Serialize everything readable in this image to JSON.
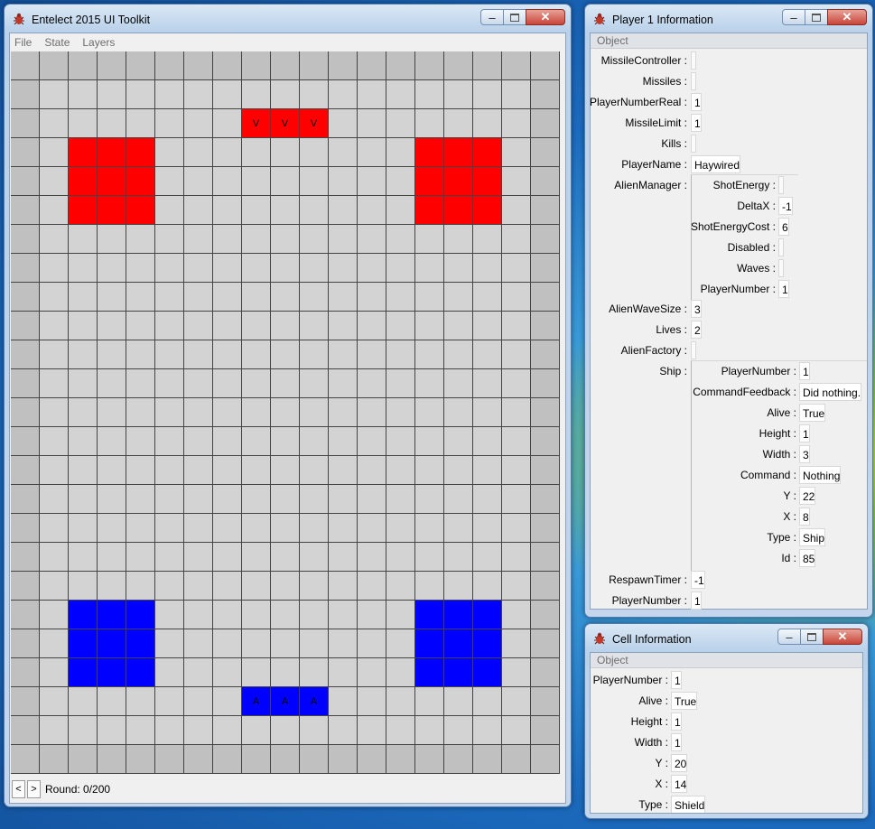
{
  "main_window": {
    "title": "Entelect 2015 UI Toolkit",
    "menu": [
      "File",
      "State",
      "Layers"
    ],
    "round_label": "Round: 0/200",
    "prev_label": "<",
    "next_label": ">"
  },
  "board": {
    "cols": 19,
    "rows": 25,
    "colors": {
      "floor": "#d3d3d3",
      "wall": "#c0c0c0",
      "red": "#ff0000",
      "blue": "#0000ff"
    },
    "red_shields": [
      [
        2,
        3
      ],
      [
        3,
        3
      ],
      [
        4,
        3
      ],
      [
        2,
        4
      ],
      [
        3,
        4
      ],
      [
        4,
        4
      ],
      [
        2,
        5
      ],
      [
        3,
        5
      ],
      [
        4,
        5
      ],
      [
        14,
        3
      ],
      [
        15,
        3
      ],
      [
        16,
        3
      ],
      [
        14,
        4
      ],
      [
        15,
        4
      ],
      [
        16,
        4
      ],
      [
        14,
        5
      ],
      [
        15,
        5
      ],
      [
        16,
        5
      ]
    ],
    "blue_shields": [
      [
        2,
        19
      ],
      [
        3,
        19
      ],
      [
        4,
        19
      ],
      [
        2,
        20
      ],
      [
        3,
        20
      ],
      [
        4,
        20
      ],
      [
        2,
        21
      ],
      [
        3,
        21
      ],
      [
        4,
        21
      ],
      [
        14,
        19
      ],
      [
        15,
        19
      ],
      [
        16,
        19
      ],
      [
        14,
        20
      ],
      [
        15,
        20
      ],
      [
        16,
        20
      ],
      [
        14,
        21
      ],
      [
        15,
        21
      ],
      [
        16,
        21
      ]
    ],
    "red_ship": {
      "glyph": "V",
      "cells": [
        [
          8,
          2
        ],
        [
          9,
          2
        ],
        [
          10,
          2
        ]
      ]
    },
    "blue_ship": {
      "glyph": "A",
      "cells": [
        [
          8,
          22
        ],
        [
          9,
          22
        ],
        [
          10,
          22
        ]
      ]
    }
  },
  "player_window": {
    "title": "Player 1 Information",
    "header": "Object",
    "fields": [
      {
        "label": "MissileController :",
        "value": ""
      },
      {
        "label": "Missiles :",
        "value": ""
      },
      {
        "label": "PlayerNumberReal :",
        "value": "1"
      },
      {
        "label": "MissileLimit :",
        "value": "1"
      },
      {
        "label": "Kills :",
        "value": ""
      },
      {
        "label": "PlayerName :",
        "value": "Haywired"
      },
      {
        "label": "AlienManager :",
        "value": null
      },
      {
        "label": "AlienWaveSize :",
        "value": "3"
      },
      {
        "label": "Lives :",
        "value": "2"
      },
      {
        "label": "AlienFactory :",
        "value": ""
      },
      {
        "label": "Ship :",
        "value": null
      },
      {
        "label": "RespawnTimer :",
        "value": "-1"
      },
      {
        "label": "PlayerNumber :",
        "value": "1"
      }
    ],
    "alien_manager": [
      {
        "label": "ShotEnergy :",
        "value": ""
      },
      {
        "label": "DeltaX :",
        "value": "-1"
      },
      {
        "label": "ShotEnergyCost :",
        "value": "6"
      },
      {
        "label": "Disabled :",
        "value": ""
      },
      {
        "label": "Waves :",
        "value": ""
      },
      {
        "label": "PlayerNumber :",
        "value": "1"
      }
    ],
    "ship": [
      {
        "label": "PlayerNumber :",
        "value": "1"
      },
      {
        "label": "CommandFeedback :",
        "value": "Did nothing."
      },
      {
        "label": "Alive :",
        "value": "True"
      },
      {
        "label": "Height :",
        "value": "1"
      },
      {
        "label": "Width :",
        "value": "3"
      },
      {
        "label": "Command :",
        "value": "Nothing"
      },
      {
        "label": "Y :",
        "value": "22"
      },
      {
        "label": "X :",
        "value": "8"
      },
      {
        "label": "Type :",
        "value": "Ship"
      },
      {
        "label": "Id :",
        "value": "85"
      }
    ]
  },
  "cell_window": {
    "title": "Cell Information",
    "header": "Object",
    "fields": [
      {
        "label": "PlayerNumber :",
        "value": "1"
      },
      {
        "label": "Alive :",
        "value": "True"
      },
      {
        "label": "Height :",
        "value": "1"
      },
      {
        "label": "Width :",
        "value": "1"
      },
      {
        "label": "Y :",
        "value": "20"
      },
      {
        "label": "X :",
        "value": "14"
      },
      {
        "label": "Type :",
        "value": "Shield"
      }
    ]
  },
  "icons": {
    "app": "bug-icon",
    "minimize": "minimize-icon",
    "maximize": "maximize-icon",
    "close": "close-icon"
  }
}
